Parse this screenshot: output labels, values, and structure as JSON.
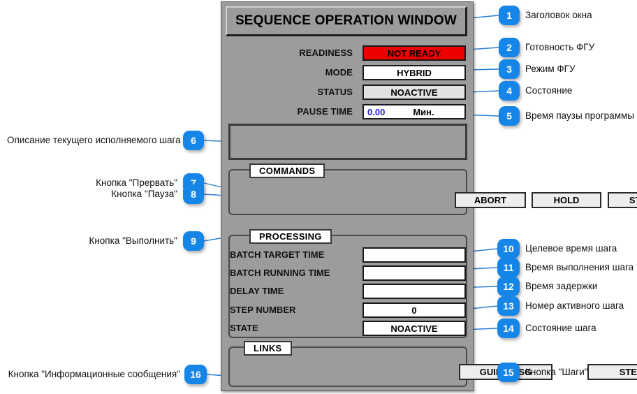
{
  "panel": {
    "title": "SEQUENCE OPERATION WINDOW",
    "fields": [
      {
        "label": "READINESS",
        "value": "NOT READY",
        "style": "red"
      },
      {
        "label": "MODE",
        "value": "HYBRID",
        "style": "white"
      },
      {
        "label": "STATUS",
        "value": "NOACTIVE",
        "style": "gray"
      },
      {
        "label": "PAUSE TIME",
        "value": "0.00",
        "unit": "Мин.",
        "style": "split"
      }
    ],
    "description_box": {
      "text": ""
    },
    "commands": {
      "title": "COMMANDS",
      "buttons": [
        {
          "label": "ABORT"
        },
        {
          "label": "HOLD"
        },
        {
          "label": "START"
        }
      ]
    },
    "processing": {
      "title": "PROCESSING",
      "rows": [
        {
          "label": "BATCH TARGET TIME",
          "value": ""
        },
        {
          "label": "BATCH RUNNING TIME",
          "value": ""
        },
        {
          "label": "DELAY TIME",
          "value": ""
        },
        {
          "label": "STEP NUMBER",
          "value": "0"
        },
        {
          "label": "STATE",
          "value": "NOACTIVE"
        }
      ]
    },
    "links": {
      "title": "LINKS",
      "buttons": [
        {
          "label": "GUIDE MSG"
        },
        {
          "label": "STEPS"
        }
      ]
    }
  },
  "callouts": [
    {
      "num": "1",
      "text": "Заголовок окна",
      "side": "right"
    },
    {
      "num": "2",
      "text": "Готовность ФГУ",
      "side": "right"
    },
    {
      "num": "3",
      "text": "Режим ФГУ",
      "side": "right"
    },
    {
      "num": "4",
      "text": "Состояние",
      "side": "right"
    },
    {
      "num": "5",
      "text": "Время паузы программы",
      "side": "right"
    },
    {
      "num": "6",
      "text": "Описание текущего исполняемого шага",
      "side": "left"
    },
    {
      "num": "7",
      "text": "Кнопка \"Прервать\"",
      "side": "left"
    },
    {
      "num": "8",
      "text": "Кнопка \"Пауза\"",
      "side": "left"
    },
    {
      "num": "9",
      "text": "Кнопка \"Выполнить\"",
      "side": "left"
    },
    {
      "num": "10",
      "text": "Целевое время шага",
      "side": "right"
    },
    {
      "num": "11",
      "text": "Время выполнения шага",
      "side": "right"
    },
    {
      "num": "12",
      "text": "Время задержки",
      "side": "right"
    },
    {
      "num": "13",
      "text": "Номер активного шага",
      "side": "right"
    },
    {
      "num": "14",
      "text": "Состояние шага",
      "side": "right"
    },
    {
      "num": "15",
      "text": "Кнопка \"Шаги\"",
      "side": "right"
    },
    {
      "num": "16",
      "text": "Кнопка \"Информационные сообщения\"",
      "side": "left"
    }
  ],
  "colors": {
    "panel_bg": "#9c9c9c",
    "badge_blue": "#1586e8",
    "leader_blue": "#2b7fd4",
    "alarm_red": "#ee0000",
    "value_blue": "#2222dd"
  }
}
